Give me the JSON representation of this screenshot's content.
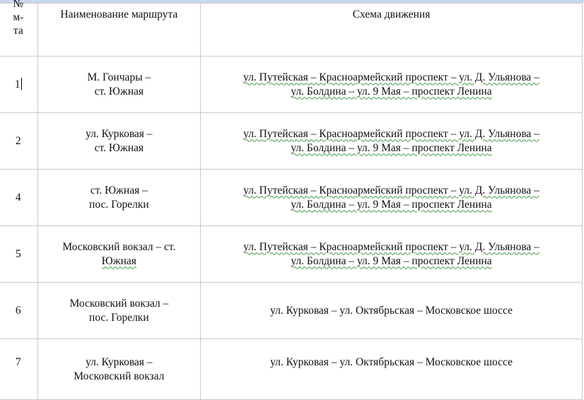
{
  "table": {
    "headers": {
      "number_lines": [
        "№",
        "м-",
        "та"
      ],
      "name": "Наименование маршрута",
      "scheme": "Схема движения"
    },
    "rows": [
      {
        "number": "1",
        "name_lines": [
          "М. Гончары –",
          "ст. Южная"
        ],
        "scheme_lines": [
          "ул. Путейская – Красноармейский проспект – ул. Д. Ульянова –",
          "ул. Болдина – ул. 9 Мая – проспект Ленина"
        ]
      },
      {
        "number": "2",
        "name_lines": [
          "ул. Курковая –",
          "ст. Южная"
        ],
        "scheme_lines": [
          "ул. Путейская – Красноармейский проспект – ул. Д. Ульянова –",
          "ул. Болдина – ул. 9 Мая – проспект Ленина"
        ]
      },
      {
        "number": "4",
        "name_lines": [
          "ст. Южная –",
          "пос. Горелки"
        ],
        "scheme_lines": [
          "ул. Путейская – Красноармейский проспект – ул. Д. Ульянова –",
          "ул. Болдина – ул. 9 Мая – проспект Ленина"
        ]
      },
      {
        "number": "5",
        "name_lines": [
          "Московский вокзал – ст.",
          "Южная"
        ],
        "scheme_lines": [
          "ул. Путейская – Красноармейский проспект – ул. Д. Ульянова –",
          "ул. Болдина – ул. 9 Мая – проспект Ленина"
        ]
      },
      {
        "number": "6",
        "name_lines": [
          "Московский вокзал –",
          "пос. Горелки"
        ],
        "scheme_lines": [
          "ул. Курковая – ул. Октябрьская – Московское шоссе"
        ]
      },
      {
        "number": "7",
        "name_lines": [
          "ул. Курковая –",
          "Московский вокзал"
        ],
        "scheme_lines": [
          "ул. Курковая – ул. Октябрьская – Московское шоссе"
        ]
      }
    ]
  }
}
